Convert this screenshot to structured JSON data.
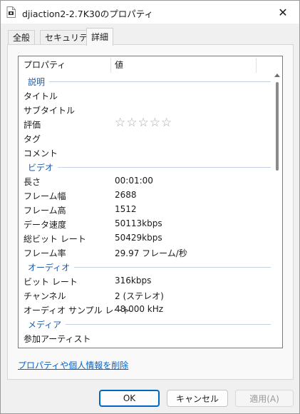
{
  "window": {
    "title": "djiaction2-2.7K30のプロパティ",
    "close_glyph": "✕"
  },
  "tabs": [
    {
      "label": "全般"
    },
    {
      "label": "セキュリティ"
    },
    {
      "label": "詳細",
      "active": true
    }
  ],
  "columns": {
    "property": "プロパティ",
    "value": "値"
  },
  "groups": {
    "description": {
      "name": "説明",
      "rows": [
        {
          "key": "タイトル",
          "value": ""
        },
        {
          "key": "サブタイトル",
          "value": ""
        },
        {
          "key": "評価",
          "rating": 0,
          "rating_max": 5,
          "star_glyph": "☆"
        },
        {
          "key": "タグ",
          "value": ""
        },
        {
          "key": "コメント",
          "value": ""
        }
      ]
    },
    "video": {
      "name": "ビデオ",
      "rows": [
        {
          "key": "長さ",
          "value": "00:01:00"
        },
        {
          "key": "フレーム幅",
          "value": "2688"
        },
        {
          "key": "フレーム高",
          "value": "1512"
        },
        {
          "key": "データ速度",
          "value": "50113kbps"
        },
        {
          "key": "総ビット レート",
          "value": "50429kbps"
        },
        {
          "key": "フレーム率",
          "value": "29.97 フレーム/秒"
        }
      ]
    },
    "audio": {
      "name": "オーディオ",
      "rows": [
        {
          "key": "ビット レート",
          "value": "316kbps"
        },
        {
          "key": "チャンネル",
          "value": "2 (ステレオ)"
        },
        {
          "key": "オーディオ サンプル レート",
          "value": "48.000 kHz"
        }
      ]
    },
    "media": {
      "name": "メディア",
      "rows": [
        {
          "key": "参加アーティスト",
          "value": ""
        }
      ]
    }
  },
  "remove_link": "プロパティや個人情報を削除",
  "buttons": {
    "ok": "OK",
    "cancel": "キャンセル",
    "apply": "適用(A)"
  },
  "colors": {
    "accent": "#0067c0",
    "group_header": "#1e5aa8",
    "link": "#0b62c4"
  }
}
